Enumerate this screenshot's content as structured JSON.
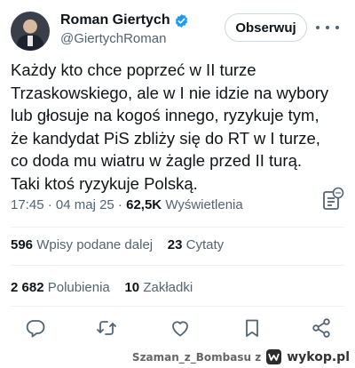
{
  "author": {
    "display_name": "Roman Giertych",
    "handle": "@GiertychRoman",
    "verified": true,
    "avatar_icon": "person-avatar-icon",
    "accent_color": "#1d9bf0"
  },
  "follow_button_label": "Obserwuj",
  "tweet": {
    "lines": [
      "Każdy kto chce poprzeć w II turze",
      "Trzaskowskiego, ale w I nie idzie na wybory",
      "lub głosuje na kogoś innego,  ryzykuje tym,",
      "że kandydat PiS zbliży się do RT w I turze,",
      "co doda mu wiatru w żagle przed II turą.",
      "Taki ktoś ryzykuje Polską."
    ]
  },
  "meta": {
    "time": "17:45",
    "separator1": " · ",
    "date": "04 maj 25",
    "separator2": " · ",
    "views": "62,5K",
    "views_label": "Wyświetlenia"
  },
  "stats": {
    "reposts_count": "596",
    "reposts_label": "Wpisy podane dalej",
    "quotes_count": "23",
    "quotes_label": "Cytaty",
    "likes_count": "2 682",
    "likes_label": "Polubienia",
    "bookmarks_count": "10",
    "bookmarks_label": "Zakładki"
  },
  "actions": [
    "reply-icon",
    "repost-icon",
    "like-icon",
    "bookmark-icon",
    "share-icon"
  ],
  "watermark": {
    "username": "Szaman_z_Bombasu z",
    "site": "wykop.pl"
  }
}
